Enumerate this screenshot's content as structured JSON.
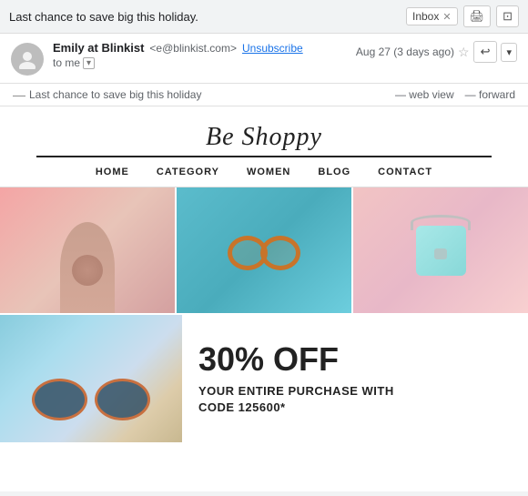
{
  "topbar": {
    "title": "Last chance to save big this holiday.",
    "inbox_label": "Inbox",
    "print_icon": "🖨",
    "expand_icon": "⊡"
  },
  "email_header": {
    "sender_name": "Emily at Blinkist",
    "sender_email": "<e@blinkist.com>",
    "unsubscribe": "Unsubscribe",
    "to_me": "to me",
    "date": "Aug 27 (3 days ago)",
    "avatar_icon": "👤"
  },
  "preview_bar": {
    "dash": "—",
    "preview_text": "Last chance to save big this holiday",
    "web_view_dash": "—",
    "web_view": "web view",
    "forward_dash": "—",
    "forward": "forward"
  },
  "email_body": {
    "brand_name": "Be Shoppy",
    "nav_items": [
      "HOME",
      "CATEGORY",
      "WOMEN",
      "BLOG",
      "CONTACT"
    ],
    "promo_discount": "30% OFF",
    "promo_line1": "YOUR ENTIRE PURCHASE WITH",
    "promo_line2": "CODE 125600*"
  }
}
